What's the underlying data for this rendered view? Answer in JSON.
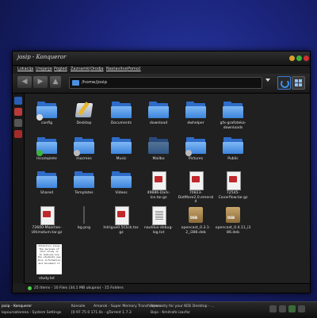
{
  "window": {
    "title": "josip - Konqueror",
    "menu": [
      "Lokacija",
      "Urejanje",
      "Pogled",
      "Zaznamki",
      "Orodja",
      "Nastavitve",
      "Pomoč"
    ]
  },
  "toolbar": {
    "location": "/home/josip"
  },
  "files": [
    {
      "name": "config",
      "type": "folder",
      "emblem": "photo"
    },
    {
      "name": "Desktop",
      "type": "desktop-folder"
    },
    {
      "name": "Documents",
      "type": "folder"
    },
    {
      "name": "download",
      "type": "folder"
    },
    {
      "name": "dwhelper",
      "type": "folder"
    },
    {
      "name": "gfx-grafoteka-downloads",
      "type": "folder"
    },
    {
      "name": "Incomplete",
      "type": "folder",
      "emblem": "green"
    },
    {
      "name": "mocmes",
      "type": "folder",
      "emblem": "doc"
    },
    {
      "name": "Music",
      "type": "folder"
    },
    {
      "name": "Mailbo",
      "type": "folder-disabled"
    },
    {
      "name": "Pictures",
      "type": "folder",
      "emblem": "pic"
    },
    {
      "name": "Public",
      "type": "folder"
    },
    {
      "name": "Shared",
      "type": "folder"
    },
    {
      "name": "Templates",
      "type": "folder"
    },
    {
      "name": "Videos",
      "type": "folder"
    },
    {
      "name": "49886-Dark-Ice.tar.gz",
      "type": "archive"
    },
    {
      "name": "70823-DotMore2.0.emerald",
      "type": "archive"
    },
    {
      "name": "72545-Coverflow.tar.gz",
      "type": "archive"
    },
    {
      "name": "72600-Moomes-Ultimatum.tar.gz",
      "type": "archive"
    },
    {
      "name": "bg.png",
      "type": "image"
    },
    {
      "name": "Intrigue0.5Click.tar.gz",
      "type": "archive"
    },
    {
      "name": "nautilus-debug-log.txt",
      "type": "text"
    },
    {
      "name": "opencast_0.3.1-2_i386.deb",
      "type": "deb"
    },
    {
      "name": "opencast_0.4.11_i386.deb",
      "type": "deb"
    },
    {
      "name": "study.txt",
      "type": "text-preview"
    }
  ],
  "preview_text": [
    "Attention study",
    "The purpose of",
    "this study is",
    "to analyse how",
    "the students use",
    "this information",
    "and document it"
  ],
  "status": "25 Items - 10 Files (34.1 MB ukupno) - 15 Folders",
  "taskbar": [
    "Konsole",
    "Amarok - Super Memory Transformers",
    "Sunny",
    "Syncosity for your KDE Desktop - ...",
    "lopoursatarena - System Settings",
    "[0 97.75 0 171.0s - gTorrent 1.7.3",
    "Bojo - Kmitrafe izacfor"
  ],
  "taskbar_active": "josip - Konqueror",
  "colors": {
    "folder": "#3d84dc",
    "accent": "#4bd14b"
  }
}
